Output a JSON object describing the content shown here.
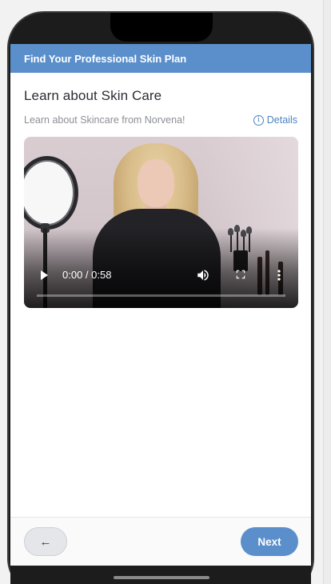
{
  "header": {
    "title": "Find Your Professional Skin Plan"
  },
  "main": {
    "title": "Learn about Skin Care",
    "subtitle": "Learn about Skincare from Norvena!",
    "details_label": "Details",
    "details_icon": "info-icon"
  },
  "video": {
    "time": "0:00 / 0:58",
    "progress": 0,
    "controls": [
      "play-icon",
      "volume-icon",
      "fullscreen-icon",
      "more-vert-icon"
    ]
  },
  "footer": {
    "back_label": "←",
    "next_label": "Next"
  },
  "colors": {
    "accent": "#5b8fcb",
    "link": "#4a83c2"
  }
}
